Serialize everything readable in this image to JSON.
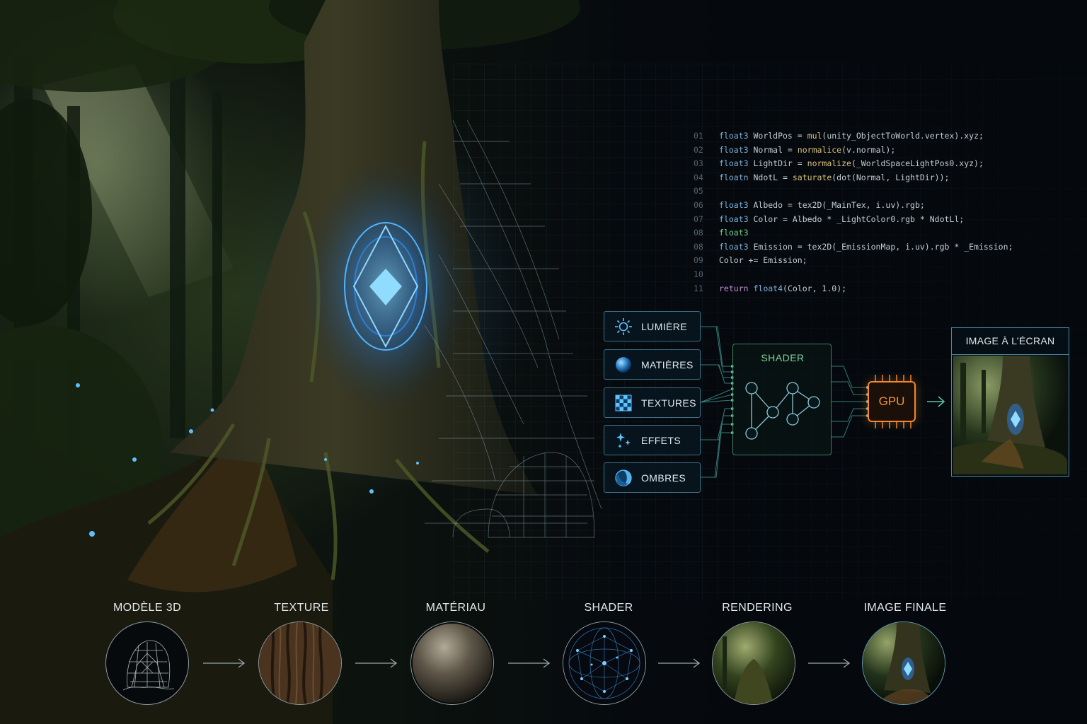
{
  "code": {
    "lines": [
      {
        "n": "01",
        "parts": [
          [
            "kw",
            "float3"
          ],
          [
            "txt",
            " WorldPos = "
          ],
          [
            "fn",
            "mul"
          ],
          [
            "txt",
            "(unity_ObjectToWorld"
          ],
          [
            "kw",
            "."
          ],
          [
            "txt",
            "vertex).xyz;"
          ]
        ]
      },
      {
        "n": "02",
        "parts": [
          [
            "kw",
            "float3"
          ],
          [
            "txt",
            " Normal = "
          ],
          [
            "fn",
            "normalice"
          ],
          [
            "txt",
            "(v.normal);"
          ]
        ]
      },
      {
        "n": "03",
        "parts": [
          [
            "kw",
            "float3"
          ],
          [
            "txt",
            " LightDir = "
          ],
          [
            "fn",
            "normalize"
          ],
          [
            "txt",
            "(_WorldSpaceLightPos0.xyz);"
          ]
        ]
      },
      {
        "n": "04",
        "parts": [
          [
            "kw",
            "floatn"
          ],
          [
            "txt",
            " NdotL = "
          ],
          [
            "fn",
            "saturate"
          ],
          [
            "txt",
            "(dot(Normal, LightDir));"
          ]
        ]
      },
      {
        "n": "05",
        "parts": []
      },
      {
        "n": "06",
        "parts": [
          [
            "kw",
            "float3"
          ],
          [
            "txt",
            " Albedo = tex2D(_MainTex, i.uv).rgb;"
          ]
        ]
      },
      {
        "n": "07",
        "parts": [
          [
            "kw",
            "float3"
          ],
          [
            "txt",
            " Color = Albedo * _LightColor0.rgb * NdotLl;"
          ]
        ]
      },
      {
        "n": "08",
        "parts": [
          [
            "grn",
            "float3"
          ]
        ]
      },
      {
        "n": "08",
        "parts": [
          [
            "kw",
            "float3"
          ],
          [
            "txt",
            " Emission = tex2D(_EmissionMap, i.uv).rgb * _Emission;"
          ]
        ]
      },
      {
        "n": "09",
        "parts": [
          [
            "txt",
            "Color += Emission;"
          ]
        ]
      },
      {
        "n": "10",
        "parts": []
      },
      {
        "n": "11",
        "parts": [
          [
            "ret",
            "return"
          ],
          [
            "txt",
            " "
          ],
          [
            "kw",
            "float4"
          ],
          [
            "txt",
            "(Color, 1.0);"
          ]
        ]
      }
    ]
  },
  "inputs": [
    {
      "label": "LUMIÈRE",
      "icon": "sun-icon"
    },
    {
      "label": "MATIÈRES",
      "icon": "sphere-icon"
    },
    {
      "label": "TEXTURES",
      "icon": "checker-icon"
    },
    {
      "label": "EFFETS",
      "icon": "sparkles-icon"
    },
    {
      "label": "OMBRES",
      "icon": "shadow-icon"
    }
  ],
  "shader_box": {
    "title": "SHADER"
  },
  "gpu": {
    "label": "GPU"
  },
  "screen": {
    "title": "IMAGE À L’ÉCRAN"
  },
  "pipeline": {
    "stages": [
      {
        "label": "MODÈLE 3D",
        "icon": "mesh-icon"
      },
      {
        "label": "TEXTURE",
        "icon": "bark-texture-icon"
      },
      {
        "label": "MATÉRIAU",
        "icon": "material-sphere-icon"
      },
      {
        "label": "SHADER",
        "icon": "shader-sphere-icon"
      },
      {
        "label": "RENDERING",
        "icon": "render-sphere-icon"
      },
      {
        "label": "IMAGE FINALE",
        "icon": "final-image-icon"
      }
    ]
  },
  "colors": {
    "accent_blue": "#3fa8ff",
    "shader_green": "#7fd39a",
    "gpu_orange": "#f7932f",
    "node_border": "#3b6f86"
  }
}
